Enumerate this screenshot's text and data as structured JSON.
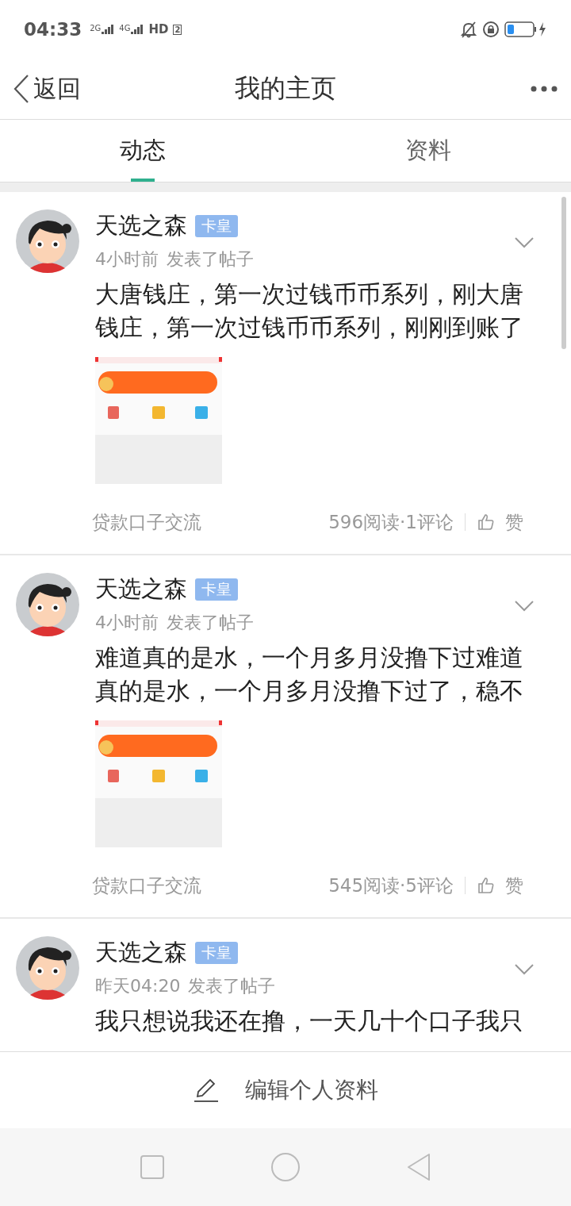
{
  "status_bar": {
    "time": "04:33",
    "signals": [
      "2G",
      "4G"
    ],
    "hd": "HD",
    "sim": "2"
  },
  "header": {
    "back": "返回",
    "title": "我的主页"
  },
  "tabs": [
    {
      "label": "动态",
      "selected": true
    },
    {
      "label": "资料",
      "selected": false
    }
  ],
  "posts": [
    {
      "author": "天选之森",
      "badge": "卡皇",
      "time": "4小时前",
      "action": "发表了帖子",
      "text": "大唐钱庄，第一次过钱币币系列，刚大唐钱庄，第一次过钱币币系列，刚刚到账了",
      "category": "贷款口子交流",
      "stats": "596阅读·1评论",
      "like": "赞"
    },
    {
      "author": "天选之森",
      "badge": "卡皇",
      "time": "4小时前",
      "action": "发表了帖子",
      "text": "难道真的是水，一个月多月没撸下过难道真的是水，一个月多月没撸下过了，稳不",
      "category": "贷款口子交流",
      "stats": "545阅读·5评论",
      "like": "赞"
    },
    {
      "author": "天选之森",
      "badge": "卡皇",
      "time": "昨天04:20",
      "action": "发表了帖子",
      "text": "我只想说我还在撸，一天几十个口子我只"
    }
  ],
  "bottom_bar": {
    "label": "编辑个人资料"
  }
}
